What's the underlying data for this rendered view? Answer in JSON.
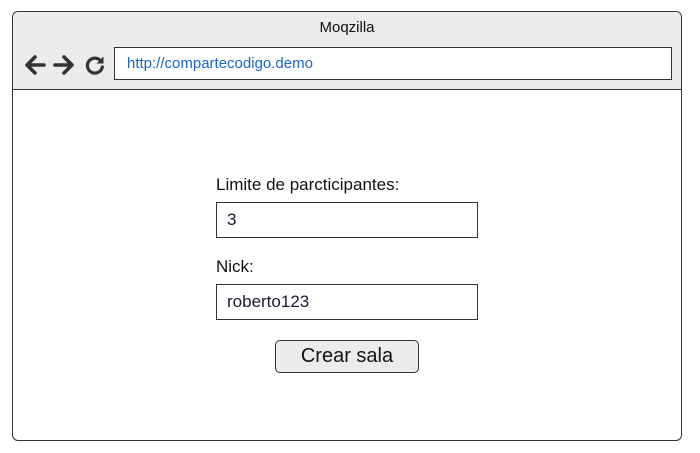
{
  "window": {
    "title": "Moqzilla"
  },
  "browser": {
    "back_icon": "arrow-left-icon",
    "forward_icon": "arrow-right-icon",
    "reload_icon": "reload-icon",
    "url": "http://compartecodigo.demo"
  },
  "form": {
    "limit_label": "Limite de parcticipantes:",
    "limit_value": "3",
    "nick_label": "Nick:",
    "nick_value": "roberto123",
    "submit_label": "Crear sala"
  },
  "colors": {
    "chrome_background": "#ebebeb",
    "url_text": "#1a66c9",
    "border": "#333333"
  }
}
